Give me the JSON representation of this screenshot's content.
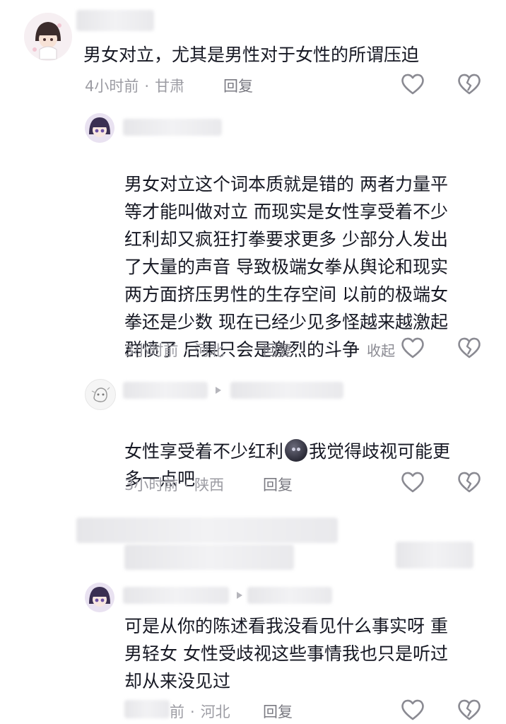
{
  "comments": [
    {
      "text": "男女对立，尤其是男性对于女性的所谓压迫",
      "time": "4小时前",
      "region": "甘肃",
      "reply_label": "回复",
      "like_icon": "heart-outline-icon",
      "dislike_icon": "broken-heart-icon"
    },
    {
      "text": "男女对立这个词本质就是错的 两者力量平\n等才能叫做对立 而现实是女性享受着不少\n红利却又疯狂打拳要求更多 少部分人发出\n了大量的声音 导致极端女拳从舆论和现实\n两方面挤压男性的生存空间 以前的极端女\n拳还是少数 现在已经少见多怪越来越激起\n群愤了 后果只会是激烈的斗争",
      "collapse_label": "收起",
      "time": "3小时前",
      "region": "河北",
      "reply_label": "回复"
    },
    {
      "text_part1": "女性享受着不少红利",
      "emoji": "dark-moon-face-emoji",
      "text_part2": "我觉得歧视可能更\n多一点吧",
      "time": "3小时前",
      "region": "陕西",
      "reply_label": "回复"
    },
    {
      "text": "可是从你的陈述看我没看见什么事实呀 重\n男轻女 女性受歧视这些事情我也只是听过\n却从来没见过",
      "region": "河北",
      "reply_label": "回复",
      "time_fragment": "前"
    }
  ],
  "colors": {
    "text": "#161823",
    "meta": "#9c9ca3",
    "icon": "#8a8a92",
    "background": "#ffffff"
  }
}
